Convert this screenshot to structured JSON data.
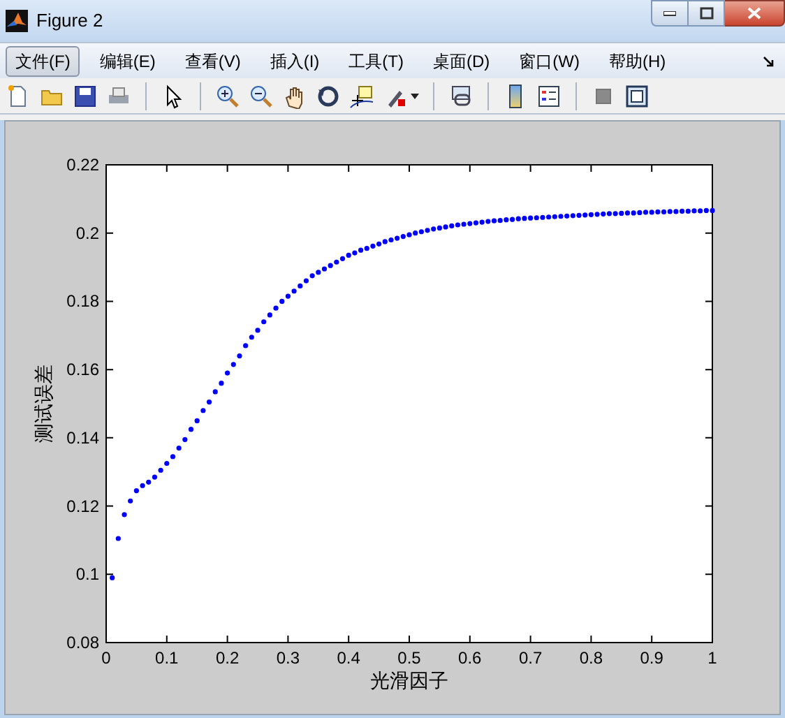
{
  "window": {
    "title": "Figure 2"
  },
  "menu": [
    {
      "label": "文件(F)",
      "selected": true
    },
    {
      "label": "编辑(E)",
      "selected": false
    },
    {
      "label": "查看(V)",
      "selected": false
    },
    {
      "label": "插入(I)",
      "selected": false
    },
    {
      "label": "工具(T)",
      "selected": false
    },
    {
      "label": "桌面(D)",
      "selected": false
    },
    {
      "label": "窗口(W)",
      "selected": false
    },
    {
      "label": "帮助(H)",
      "selected": false
    }
  ],
  "plot": {
    "chart_data": {
      "type": "scatter",
      "xlabel": "光滑因子",
      "ylabel": "测试误差",
      "xlim": [
        0,
        1
      ],
      "ylim": [
        0.08,
        0.22
      ],
      "xticks": [
        {
          "value": 0,
          "label": "0"
        },
        {
          "value": 0.1,
          "label": "0.1"
        },
        {
          "value": 0.2,
          "label": "0.2"
        },
        {
          "value": 0.3,
          "label": "0.3"
        },
        {
          "value": 0.4,
          "label": "0.4"
        },
        {
          "value": 0.5,
          "label": "0.5"
        },
        {
          "value": 0.6,
          "label": "0.6"
        },
        {
          "value": 0.7,
          "label": "0.7"
        },
        {
          "value": 0.8,
          "label": "0.8"
        },
        {
          "value": 0.9,
          "label": "0.9"
        },
        {
          "value": 1,
          "label": "1"
        }
      ],
      "yticks": [
        {
          "value": 0.08,
          "label": "0.08"
        },
        {
          "value": 0.1,
          "label": "0.1"
        },
        {
          "value": 0.12,
          "label": "0.12"
        },
        {
          "value": 0.14,
          "label": "0.14"
        },
        {
          "value": 0.16,
          "label": "0.16"
        },
        {
          "value": 0.18,
          "label": "0.18"
        },
        {
          "value": 0.2,
          "label": "0.2"
        },
        {
          "value": 0.22,
          "label": "0.22"
        }
      ],
      "x": [
        0.01,
        0.02,
        0.03,
        0.04,
        0.05,
        0.06,
        0.07,
        0.08,
        0.09,
        0.1,
        0.11,
        0.12,
        0.13,
        0.14,
        0.15,
        0.16,
        0.17,
        0.18,
        0.19,
        0.2,
        0.21,
        0.22,
        0.23,
        0.24,
        0.25,
        0.26,
        0.27,
        0.28,
        0.29,
        0.3,
        0.31,
        0.32,
        0.33,
        0.34,
        0.35,
        0.36,
        0.37,
        0.38,
        0.39,
        0.4,
        0.41,
        0.42,
        0.43,
        0.44,
        0.45,
        0.46,
        0.47,
        0.48,
        0.49,
        0.5,
        0.51,
        0.52,
        0.53,
        0.54,
        0.55,
        0.56,
        0.57,
        0.58,
        0.59,
        0.6,
        0.61,
        0.62,
        0.63,
        0.64,
        0.65,
        0.66,
        0.67,
        0.68,
        0.69,
        0.7,
        0.71,
        0.72,
        0.73,
        0.74,
        0.75,
        0.76,
        0.77,
        0.78,
        0.79,
        0.8,
        0.81,
        0.82,
        0.83,
        0.84,
        0.85,
        0.86,
        0.87,
        0.88,
        0.89,
        0.9,
        0.91,
        0.92,
        0.93,
        0.94,
        0.95,
        0.96,
        0.97,
        0.98,
        0.99,
        1.0
      ],
      "series": [
        {
          "color": "#0000ff",
          "values": [
            0.099,
            0.1105,
            0.1175,
            0.1215,
            0.1245,
            0.126,
            0.127,
            0.1285,
            0.1305,
            0.1325,
            0.1345,
            0.137,
            0.1395,
            0.1425,
            0.145,
            0.148,
            0.1505,
            0.1535,
            0.156,
            0.159,
            0.1615,
            0.164,
            0.167,
            0.1695,
            0.1715,
            0.174,
            0.176,
            0.178,
            0.18,
            0.1815,
            0.183,
            0.1845,
            0.186,
            0.1875,
            0.1885,
            0.1895,
            0.1905,
            0.1915,
            0.1925,
            0.1935,
            0.1942,
            0.195,
            0.1955,
            0.1962,
            0.1968,
            0.1975,
            0.198,
            0.1985,
            0.199,
            0.1995,
            0.2,
            0.2004,
            0.2008,
            0.2012,
            0.2015,
            0.2018,
            0.2021,
            0.2024,
            0.2026,
            0.2028,
            0.203,
            0.2032,
            0.2034,
            0.2036,
            0.2037,
            0.2039,
            0.204,
            0.2042,
            0.2043,
            0.2044,
            0.2045,
            0.2046,
            0.2047,
            0.2048,
            0.2049,
            0.205,
            0.2051,
            0.2052,
            0.2053,
            0.2054,
            0.2055,
            0.2056,
            0.2057,
            0.2057,
            0.2058,
            0.2059,
            0.2059,
            0.206,
            0.2061,
            0.2061,
            0.2062,
            0.2062,
            0.2063,
            0.2063,
            0.2064,
            0.2064,
            0.2065,
            0.2065,
            0.2066,
            0.2066
          ]
        }
      ]
    }
  }
}
